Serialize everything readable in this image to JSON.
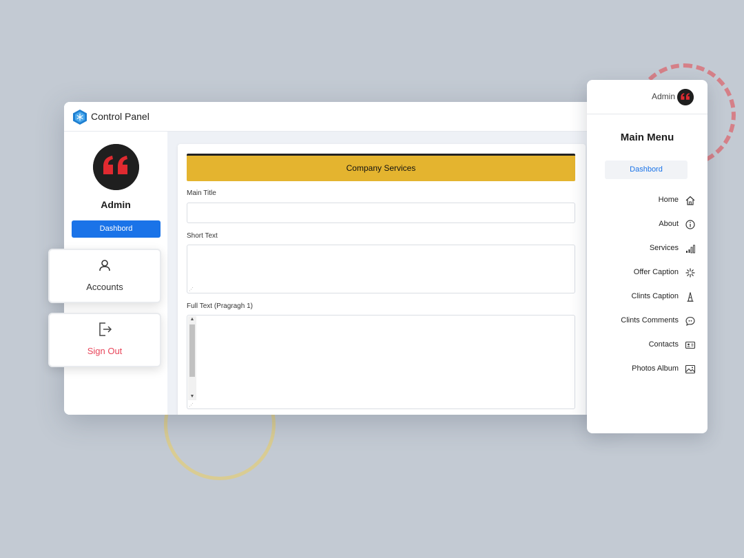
{
  "app": {
    "title": "Control Panel"
  },
  "left_panel": {
    "user_name": "Admin",
    "dashboard_label": "Dashbord"
  },
  "content": {
    "section_title": "Company Services",
    "fields": [
      {
        "label": "Main Title",
        "value": ""
      },
      {
        "label": "Short Text",
        "value": ""
      },
      {
        "label": "Full Text (Pragragh 1)",
        "value": ""
      }
    ]
  },
  "floating_cards": [
    {
      "label": "Accounts",
      "icon": "user-icon"
    },
    {
      "label": "Sign Out",
      "icon": "sign-out-icon",
      "color": "#e8455a"
    }
  ],
  "main_menu": {
    "user_name": "Admin",
    "title": "Main Menu",
    "dashboard_label": "Dashbord",
    "items": [
      {
        "label": "Home",
        "icon": "home-icon"
      },
      {
        "label": "About",
        "icon": "info-icon"
      },
      {
        "label": "Services",
        "icon": "signal-bars-icon"
      },
      {
        "label": "Offer Caption",
        "icon": "sparkle-icon"
      },
      {
        "label": "Clints Caption",
        "icon": "tower-icon"
      },
      {
        "label": "Clints Comments",
        "icon": "comment-icon"
      },
      {
        "label": "Contacts",
        "icon": "contact-card-icon"
      },
      {
        "label": "Photos Album",
        "icon": "image-icon"
      }
    ]
  },
  "colors": {
    "accent_blue": "#1a73e8",
    "banner_yellow": "#e4b42f",
    "sign_out_red": "#e8455a",
    "background": "#c3cad3"
  }
}
